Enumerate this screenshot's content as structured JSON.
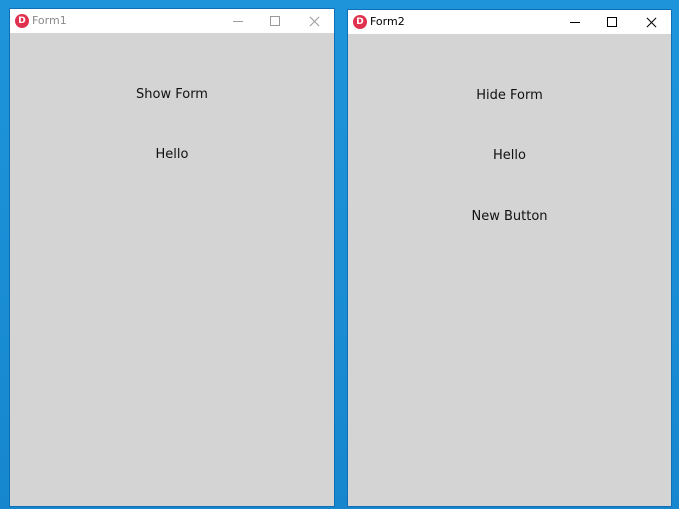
{
  "form1": {
    "title": "Form1",
    "logo_letter": "D",
    "buttons": {
      "show_form": "Show Form",
      "hello": "Hello"
    },
    "title_state": "inactive"
  },
  "form2": {
    "title": "Form2",
    "logo_letter": "D",
    "buttons": {
      "hide_form": "Hide Form",
      "hello": "Hello",
      "new_button": "New Button"
    },
    "title_state": "active"
  },
  "colors": {
    "desktop": "#1a8fd6",
    "window_body": "#d4d4d4",
    "titlebar": "#ffffff",
    "logo": "#e0314e"
  },
  "icons": {
    "minimize": "minimize-icon",
    "maximize": "maximize-icon",
    "close": "close-icon",
    "app_logo": "delphi-logo-icon"
  }
}
